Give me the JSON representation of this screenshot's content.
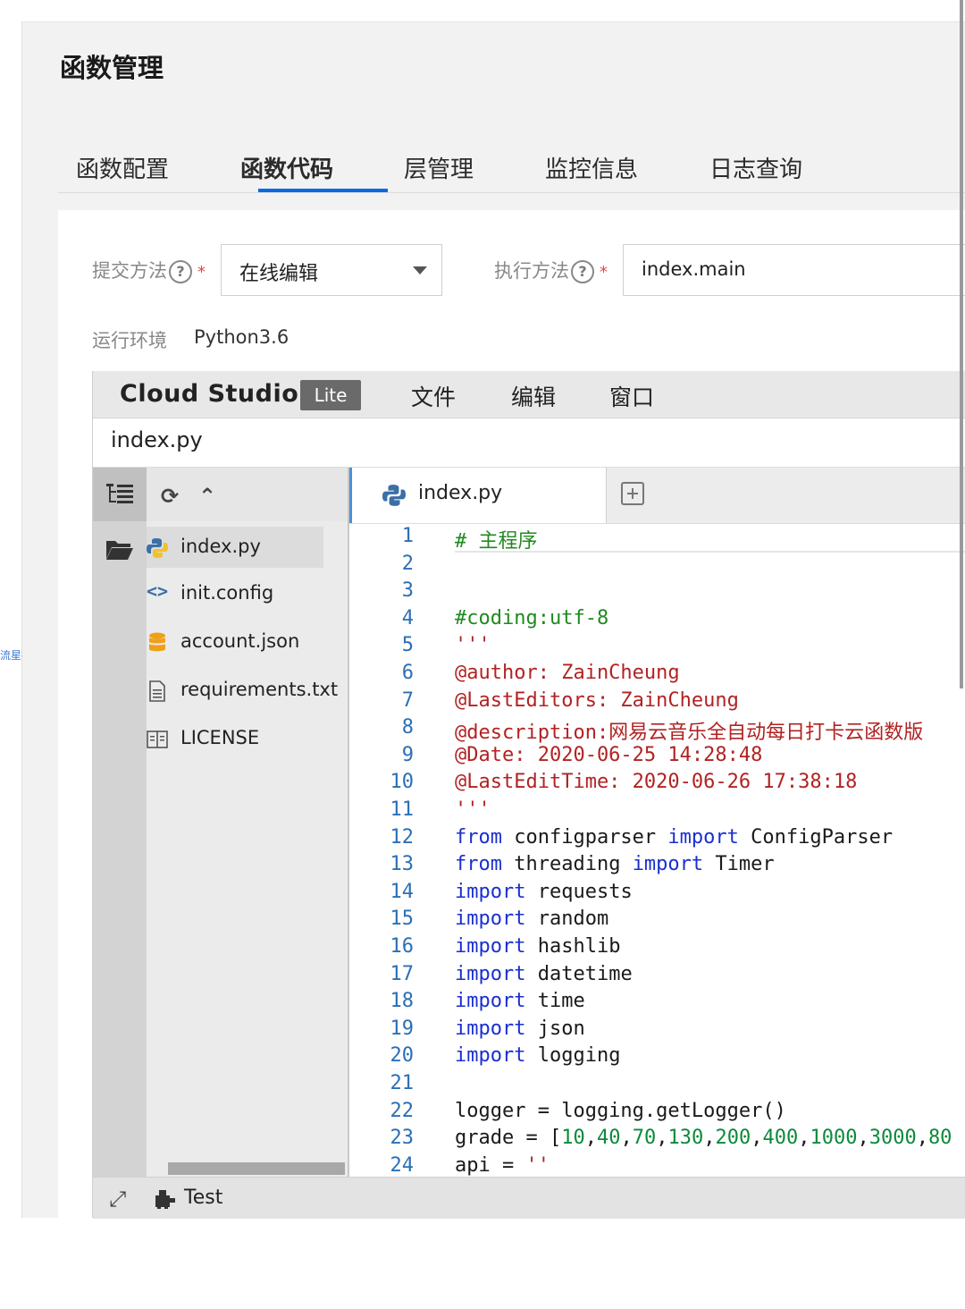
{
  "watermark": "流星社区",
  "page": {
    "title": "函数管理"
  },
  "tabs": [
    {
      "label": "函数配置"
    },
    {
      "label": "函数代码",
      "active": true
    },
    {
      "label": "层管理"
    },
    {
      "label": "监控信息"
    },
    {
      "label": "日志查询"
    }
  ],
  "form": {
    "submit_label": "提交方法",
    "submit_value": "在线编辑",
    "exec_label": "执行方法",
    "exec_value": "index.main",
    "help_glyph": "?",
    "required_mark": "*",
    "runtime_label": "运行环境",
    "runtime_value": "Python3.6"
  },
  "ide": {
    "brand": "Cloud Studio",
    "badge": "Lite",
    "menu": [
      "文件",
      "编辑",
      "窗口"
    ],
    "path": "index.py",
    "files": [
      {
        "name": "index.py",
        "icon": "python-icon",
        "selected": true
      },
      {
        "name": "init.config",
        "icon": "code-icon"
      },
      {
        "name": "account.json",
        "icon": "database-icon"
      },
      {
        "name": "requirements.txt",
        "icon": "text-file-icon"
      },
      {
        "name": "LICENSE",
        "icon": "book-icon"
      }
    ],
    "editor_tab": "index.py",
    "status_test": "Test",
    "accent": "#4b8fd6"
  },
  "code_lines": [
    {
      "n": "1",
      "html": "<span class=\"cm\"># 主程序</span>"
    },
    {
      "n": "2",
      "html": ""
    },
    {
      "n": "3",
      "html": ""
    },
    {
      "n": "4",
      "html": "<span class=\"cm\">#coding:utf-8</span>"
    },
    {
      "n": "5",
      "html": "<span class=\"st\">'''</span>"
    },
    {
      "n": "6",
      "html": "<span class=\"st\">@author: ZainCheung</span>"
    },
    {
      "n": "7",
      "html": "<span class=\"st\">@LastEditors: ZainCheung</span>"
    },
    {
      "n": "8",
      "html": "<span class=\"st\">@description:网易云音乐全自动每日打卡云函数版</span>"
    },
    {
      "n": "9",
      "html": "<span class=\"st\">@Date: 2020-06-25 14:28:48</span>"
    },
    {
      "n": "10",
      "html": "<span class=\"st\">@LastEditTime: 2020-06-26 17:38:18</span>"
    },
    {
      "n": "11",
      "html": "<span class=\"st\">'''</span>"
    },
    {
      "n": "12",
      "html": "<span class=\"kw\">from</span> configparser <span class=\"kw\">import</span> ConfigParser"
    },
    {
      "n": "13",
      "html": "<span class=\"kw\">from</span> threading <span class=\"kw\">import</span> Timer"
    },
    {
      "n": "14",
      "html": "<span class=\"kw\">import</span> requests"
    },
    {
      "n": "15",
      "html": "<span class=\"kw\">import</span> random"
    },
    {
      "n": "16",
      "html": "<span class=\"kw\">import</span> hashlib"
    },
    {
      "n": "17",
      "html": "<span class=\"kw\">import</span> datetime"
    },
    {
      "n": "18",
      "html": "<span class=\"kw\">import</span> time"
    },
    {
      "n": "19",
      "html": "<span class=\"kw\">import</span> json"
    },
    {
      "n": "20",
      "html": "<span class=\"kw\">import</span> logging"
    },
    {
      "n": "21",
      "html": ""
    },
    {
      "n": "22",
      "html": "logger = logging.getLogger()"
    },
    {
      "n": "23",
      "html": "grade = [<span class=\"nm\">10</span>,<span class=\"nm\">40</span>,<span class=\"nm\">70</span>,<span class=\"nm\">130</span>,<span class=\"nm\">200</span>,<span class=\"nm\">400</span>,<span class=\"nm\">1000</span>,<span class=\"nm\">3000</span>,<span class=\"nm\">80</span>"
    },
    {
      "n": "24",
      "html": "api = <span class=\"st\">''</span>"
    }
  ]
}
